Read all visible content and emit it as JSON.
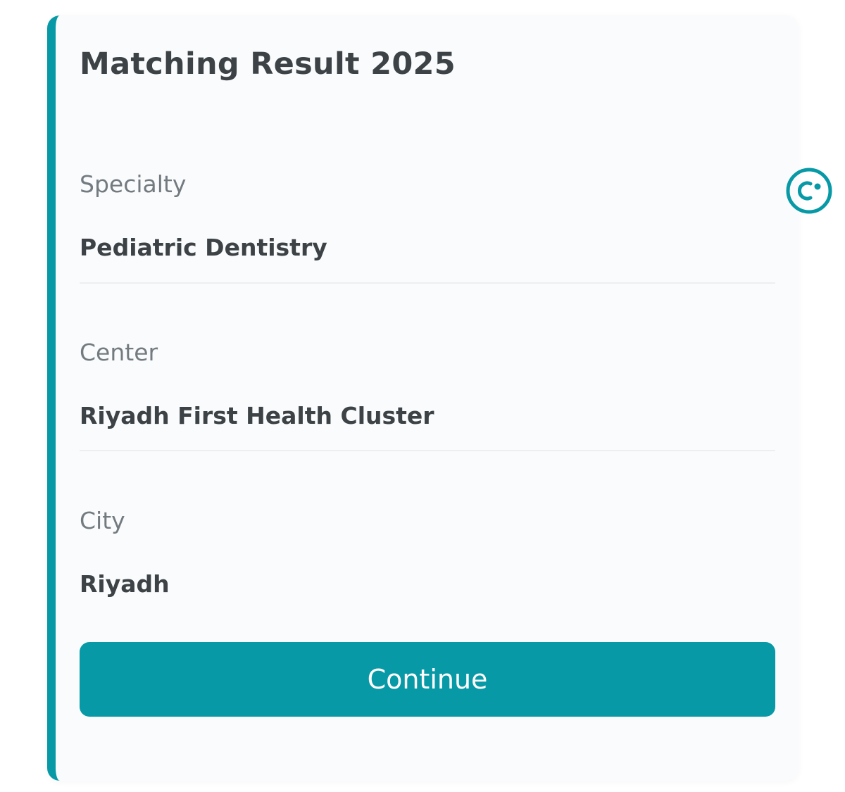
{
  "card": {
    "title": "Matching Result 2025",
    "fields": [
      {
        "label": "Specialty",
        "value": "Pediatric Dentistry"
      },
      {
        "label": "Center",
        "value": "Riyadh First Health Cluster"
      },
      {
        "label": "City",
        "value": "Riyadh"
      }
    ],
    "continue_label": "Continue"
  },
  "colors": {
    "accent": "#0799a6",
    "text_dark": "#3c4245",
    "text_muted": "#737b80",
    "card_background": "#fafbfc"
  },
  "side_widget": {
    "icon": "chat-assistant-icon"
  }
}
